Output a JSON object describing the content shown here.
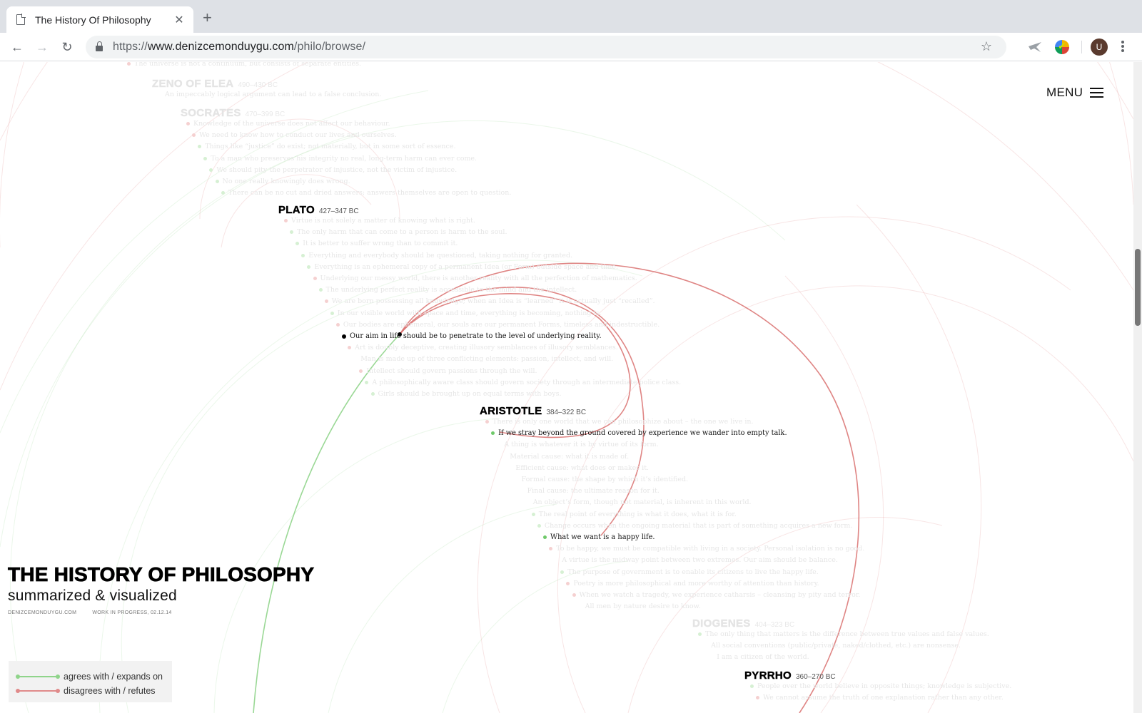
{
  "browser": {
    "tab_title": "The History Of Philosophy",
    "tab_close_glyph": "✕",
    "new_tab_glyph": "+",
    "back_glyph": "←",
    "forward_glyph": "→",
    "reload_glyph": "↻",
    "url_scheme": "https://",
    "url_host": "www.denizcemonduygu.com",
    "url_path": "/philo/browse/",
    "bookmark_glyph": "☆",
    "avatar_letter": "U"
  },
  "menu": {
    "label": "MENU"
  },
  "title_block": {
    "title": "THE HISTORY OF PHILOSOPHY",
    "subtitle": "summarized & visualized",
    "site": "DENIZCEMONDUYGU.COM",
    "status": "WORK IN PROGRESS, 02.12.14"
  },
  "legend": {
    "agrees": {
      "label": "agrees with / expands on",
      "color": "#8fd48a"
    },
    "disagrees": {
      "label": "disagrees with / refutes",
      "color": "#e08a8a"
    }
  },
  "colors": {
    "agree_line": "#8fd48a",
    "disagree_line": "#d9706f",
    "faded_text": "#e6e6e6"
  },
  "philosophers": [
    {
      "name": "",
      "dates": "",
      "faded": true,
      "ideas": [
        {
          "text": "The universe is not a continuum, but consists of separate entities.",
          "stance": "r"
        }
      ]
    },
    {
      "name": "ZENO OF ELEA",
      "dates": "490–430 BC",
      "faded": true,
      "ideas": [
        {
          "text": "An impeccably logical argument can lead to a false conclusion.",
          "stance": "none"
        }
      ]
    },
    {
      "name": "SOCRATES",
      "dates": "470–399 BC",
      "faded": true,
      "ideas": [
        {
          "text": "Knowledge of the universe does not affect our behaviour.",
          "stance": "r"
        },
        {
          "text": "We need to know how to conduct our lives and ourselves.",
          "stance": "r"
        },
        {
          "text": "Things like “justice” do exist; not materially, but in some sort of essence.",
          "stance": "g"
        },
        {
          "text": "To a man who preserves his integrity no real, long-term harm can ever come.",
          "stance": "g"
        },
        {
          "text": "We should pity the perpetrator of injustice, not the victim of injustice.",
          "stance": "g"
        },
        {
          "text": "No one really knowingly does wrong.",
          "stance": "g"
        },
        {
          "text": "There can be no cut and dried answers; answers themselves are open to question.",
          "stance": "g"
        }
      ]
    },
    {
      "name": "PLATO",
      "dates": "427–347 BC",
      "faded": false,
      "ideas": [
        {
          "text": "Virtue is not solely a matter of knowing what is right.",
          "stance": "r"
        },
        {
          "text": "The only harm that can come to a person is harm to the soul.",
          "stance": "g"
        },
        {
          "text": "It is better to suffer wrong than to commit it.",
          "stance": "g"
        },
        {
          "text": "Everything and everybody should be questioned, taking nothing for granted.",
          "stance": "g"
        },
        {
          "text": "Everything is an ephemeral copy of a permanent Idea (or Form) outside space and time.",
          "stance": "g"
        },
        {
          "text": "Underlying our messy world, there is another reality with all the perfection of mathematics.",
          "stance": "r"
        },
        {
          "text": "The underlying perfect reality is accessible to the mind and the intellect.",
          "stance": "g"
        },
        {
          "text": "We are born possessing all knowledge; when an Idea is “learned” it is actually just “recalled”.",
          "stance": "r"
        },
        {
          "text": "In our visible world with space and time, everything is becoming, nothing is.",
          "stance": "g"
        },
        {
          "text": "Our bodies are ephemeral, our souls are our permanent Forms, timeless and indestructible.",
          "stance": "r"
        },
        {
          "text": "Our aim in life should be to penetrate to the level of underlying reality.",
          "stance": "k",
          "active": true
        },
        {
          "text": "Art is doubly deceptive, creating illusory semblances of illusory semblances.",
          "stance": "r"
        },
        {
          "text": "Man is made up of three conflicting elements: passion, intellect, and will.",
          "stance": "none"
        },
        {
          "text": "Intellect should govern passions through the will.",
          "stance": "r"
        },
        {
          "text": "A philosophically aware class should govern society through an intermediate police class.",
          "stance": "g"
        },
        {
          "text": "Girls should be brought up on equal terms with boys.",
          "stance": "g"
        }
      ]
    },
    {
      "name": "ARISTOTLE",
      "dates": "384–322 BC",
      "faded": false,
      "ideas": [
        {
          "text": "There is only one world that we can philosophize about – the one we live in.",
          "stance": "r"
        },
        {
          "text": "If we stray beyond the ground covered by experience we wander into empty talk.",
          "stance": "g",
          "active": true
        },
        {
          "text": "A thing is whatever it is by virtue of its form.",
          "stance": "none"
        },
        {
          "text": "Material cause: what it is made of.",
          "stance": "none"
        },
        {
          "text": "Efficient cause: what does or makes it.",
          "stance": "none"
        },
        {
          "text": "Formal cause: the shape by which it’s identified.",
          "stance": "none"
        },
        {
          "text": "Final cause: the ultimate reason for it.",
          "stance": "none"
        },
        {
          "text": "An object’s form, though not material, is inherent in this world.",
          "stance": "none"
        },
        {
          "text": "The real point of everything is what it does, what it is for.",
          "stance": "g"
        },
        {
          "text": "Change occurs when the ongoing material that is part of something acquires a new form.",
          "stance": "g"
        },
        {
          "text": "What we want is a happy life.",
          "stance": "g",
          "active": true
        },
        {
          "text": "To be happy, we must be compatible with living in a society. Personal isolation is no good.",
          "stance": "r"
        },
        {
          "text": "A virtue is the midway point between two extremes. Our aim should be balance.",
          "stance": "none"
        },
        {
          "text": "The purpose of government is to enable its citizens to live the happy life.",
          "stance": "g"
        },
        {
          "text": "Poetry is more philosophical and more worthy of attention than history.",
          "stance": "r"
        },
        {
          "text": "When we watch a tragedy, we experience catharsis – cleansing by pity and terror.",
          "stance": "r"
        },
        {
          "text": "All men by nature desire to know.",
          "stance": "none"
        }
      ]
    },
    {
      "name": "DIOGENES",
      "dates": "404–323 BC",
      "faded": true,
      "ideas": [
        {
          "text": "The only thing that matters is the difference between true values and false values.",
          "stance": "g"
        },
        {
          "text": "All social conventions (public/private, naked/clothed, etc.) are nonsense.",
          "stance": "none"
        },
        {
          "text": "I am a citizen of the world.",
          "stance": "none"
        }
      ]
    },
    {
      "name": "PYRRHO",
      "dates": "360–270 BC",
      "faded": false,
      "ideas": [
        {
          "text": "People over the world believe in opposite things; knowledge is subjective.",
          "stance": "g"
        },
        {
          "text": "We cannot assume the truth of one explanation rather than any other.",
          "stance": "r"
        }
      ]
    }
  ]
}
